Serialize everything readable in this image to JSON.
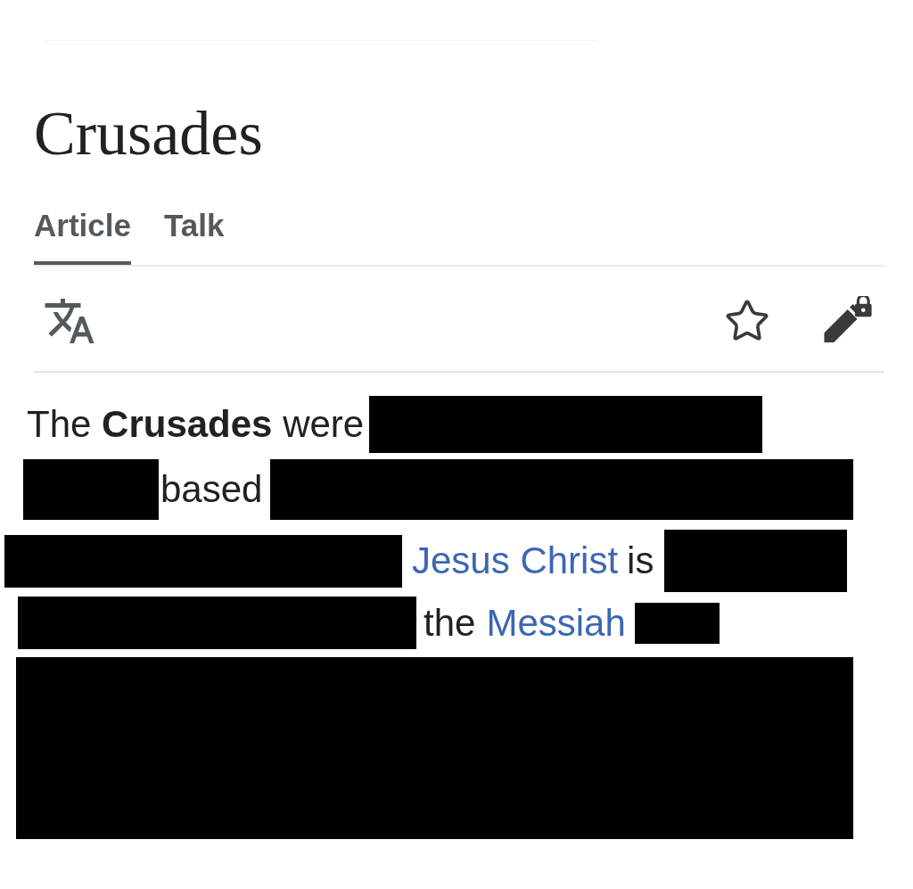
{
  "page": {
    "title": "Crusades"
  },
  "tabs": [
    {
      "label": "Article",
      "selected": true
    },
    {
      "label": "Talk",
      "selected": false
    }
  ],
  "paragraph": {
    "lines": [
      {
        "segments": [
          {
            "kind": "text",
            "text": "The **Crusades** were"
          },
          {
            "kind": "redaction"
          }
        ]
      },
      {
        "segments": [
          {
            "kind": "redaction"
          },
          {
            "kind": "text",
            "text": "based"
          },
          {
            "kind": "redaction"
          }
        ]
      },
      {
        "segments": [
          {
            "kind": "redaction"
          },
          {
            "kind": "link",
            "text": "Jesus Christ"
          },
          {
            "kind": "text",
            "text": "is"
          },
          {
            "kind": "redaction"
          }
        ]
      },
      {
        "segments": [
          {
            "kind": "redaction"
          },
          {
            "kind": "text",
            "text": "the"
          },
          {
            "kind": "link",
            "text": "Messiah"
          },
          {
            "kind": "redaction"
          }
        ]
      },
      {
        "segments": [
          {
            "kind": "redaction"
          }
        ]
      }
    ]
  }
}
